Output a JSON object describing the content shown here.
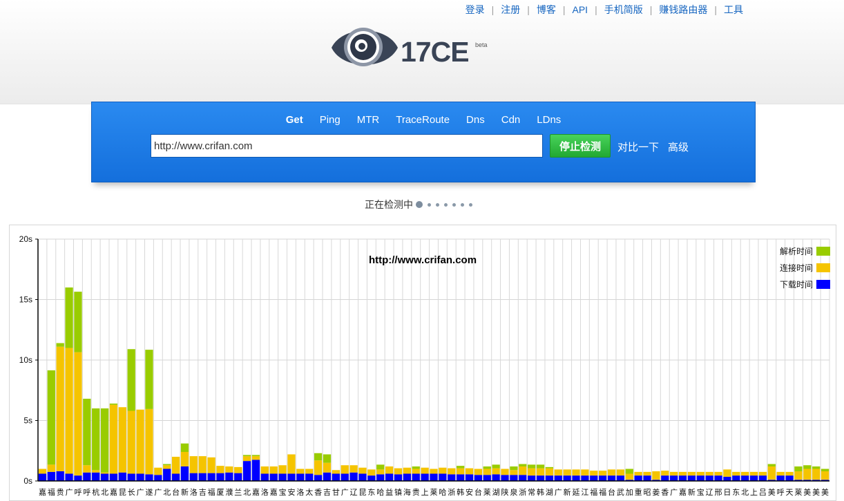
{
  "nav": {
    "links": [
      "登录",
      "注册",
      "博客",
      "API",
      "手机简版",
      "赚钱路由器",
      "工具"
    ]
  },
  "brand": {
    "name": "17CE",
    "badge": "beta"
  },
  "tabs": [
    {
      "label": "Get",
      "active": true
    },
    {
      "label": "Ping"
    },
    {
      "label": "MTR"
    },
    {
      "label": "TraceRoute"
    },
    {
      "label": "Dns"
    },
    {
      "label": "Cdn"
    },
    {
      "label": "LDns"
    }
  ],
  "search": {
    "value": "http://www.crifan.com"
  },
  "actions": {
    "stop_label": "停止检测",
    "compare_label": "对比一下",
    "advanced_label": "高级"
  },
  "status": {
    "text": "正在检测中"
  },
  "colors": {
    "resolve": "#99cc00",
    "connect": "#f5c400",
    "download": "#0000ff",
    "panel": "#1f7fe6",
    "stop": "#33bb44"
  },
  "chart_data": {
    "type": "bar",
    "stacked": true,
    "title": "http://www.crifan.com",
    "xlabel": "",
    "ylabel": "",
    "ylim": [
      0,
      20
    ],
    "yticks": [
      "0s",
      "5s",
      "10s",
      "15s",
      "20s"
    ],
    "legend_position": "top-right",
    "grid": true,
    "categories": [
      "嘉",
      "福",
      "贵",
      "广",
      "呼",
      "呼",
      "杭",
      "北",
      "嘉",
      "昆",
      "长",
      "广",
      "遂",
      "广",
      "北",
      "台",
      "新",
      "洛",
      "吉",
      "福",
      "厦",
      "濮",
      "兰",
      "北",
      "嘉",
      "洛",
      "嘉",
      "宝",
      "安",
      "洛",
      "太",
      "香",
      "吉",
      "甘",
      "广",
      "辽",
      "昆",
      "东",
      "哈",
      "益",
      "镇",
      "海",
      "贵",
      "上",
      "莱",
      "哈",
      "浙",
      "韩",
      "安",
      "台",
      "莱",
      "湖",
      "陕",
      "泉",
      "浙",
      "常",
      "韩",
      "湖",
      "广",
      "新",
      "延",
      "江",
      "福",
      "福",
      "台",
      "武",
      "加",
      "重",
      "昭",
      "姜",
      "香",
      "广",
      "嘉",
      "新",
      "宝",
      "辽",
      "邢",
      "日",
      "东",
      "北",
      "上",
      "吕",
      "美",
      "呼",
      "天",
      "莱",
      "美",
      "美",
      "美"
    ],
    "series": [
      {
        "name": "下载时间",
        "values": [
          0.6,
          0.75,
          0.8,
          0.6,
          0.45,
          0.7,
          0.7,
          0.6,
          0.6,
          0.7,
          0.6,
          0.6,
          0.55,
          0.5,
          1.0,
          0.6,
          1.2,
          0.65,
          0.65,
          0.65,
          0.65,
          0.7,
          0.65,
          1.65,
          1.75,
          0.6,
          0.6,
          0.6,
          0.6,
          0.6,
          0.6,
          0.5,
          0.7,
          0.6,
          0.6,
          0.7,
          0.6,
          0.45,
          0.55,
          0.6,
          0.55,
          0.6,
          0.6,
          0.6,
          0.6,
          0.6,
          0.55,
          0.55,
          0.55,
          0.5,
          0.5,
          0.55,
          0.5,
          0.5,
          0.5,
          0.45,
          0.45,
          0.45,
          0.45,
          0.45,
          0.45,
          0.45,
          0.45,
          0.45,
          0.45,
          0.45,
          0.1,
          0.45,
          0.45,
          0.1,
          0.45,
          0.45,
          0.45,
          0.45,
          0.45,
          0.45,
          0.45,
          0.35,
          0.45,
          0.45,
          0.45,
          0.45,
          0.1,
          0.45,
          0.45,
          0.1,
          0.1,
          0.1,
          0.1
        ]
      },
      {
        "name": "连接时间",
        "values": [
          0.4,
          0.6,
          10.3,
          10.4,
          10.2,
          0.6,
          0.2,
          0.1,
          5.7,
          5.4,
          5.2,
          5.3,
          5.4,
          0.6,
          0.3,
          1.4,
          1.2,
          1.4,
          1.4,
          1.3,
          0.6,
          0.5,
          0.5,
          0.4,
          0.3,
          0.6,
          0.6,
          0.7,
          1.6,
          0.4,
          0.4,
          1.2,
          0.8,
          0.3,
          0.7,
          0.6,
          0.5,
          0.5,
          0.4,
          0.6,
          0.5,
          0.5,
          0.4,
          0.5,
          0.4,
          0.5,
          0.5,
          0.5,
          0.5,
          0.5,
          0.5,
          0.5,
          0.5,
          0.4,
          0.7,
          0.6,
          0.6,
          0.6,
          0.5,
          0.5,
          0.5,
          0.5,
          0.4,
          0.4,
          0.5,
          0.5,
          0.5,
          0.3,
          0.3,
          0.7,
          0.4,
          0.3,
          0.3,
          0.3,
          0.3,
          0.3,
          0.3,
          0.6,
          0.3,
          0.3,
          0.3,
          0.3,
          1.1,
          0.3,
          0.3,
          0.7,
          0.9,
          0.9,
          0.7
        ]
      },
      {
        "name": "解析时间",
        "values": [
          0.0,
          7.8,
          0.3,
          5.0,
          5.0,
          5.5,
          5.1,
          5.3,
          0.1,
          0.0,
          5.1,
          0.0,
          4.9,
          0.0,
          0.1,
          0.0,
          0.7,
          0.0,
          0.0,
          0.0,
          0.0,
          0.0,
          0.0,
          0.1,
          0.1,
          0.0,
          0.0,
          0.0,
          0.0,
          0.0,
          0.0,
          0.6,
          0.7,
          0.0,
          0.0,
          0.0,
          0.0,
          0.0,
          0.4,
          0.0,
          0.0,
          0.0,
          0.2,
          0.0,
          0.0,
          0.0,
          0.0,
          0.2,
          0.0,
          0.0,
          0.2,
          0.3,
          0.0,
          0.3,
          0.2,
          0.3,
          0.3,
          0.1,
          0.0,
          0.0,
          0.0,
          0.0,
          0.0,
          0.0,
          0.0,
          0.0,
          0.4,
          0.0,
          0.0,
          0.0,
          0.0,
          0.0,
          0.0,
          0.0,
          0.0,
          0.0,
          0.0,
          0.0,
          0.0,
          0.0,
          0.0,
          0.0,
          0.2,
          0.0,
          0.0,
          0.4,
          0.3,
          0.2,
          0.2
        ]
      }
    ]
  }
}
